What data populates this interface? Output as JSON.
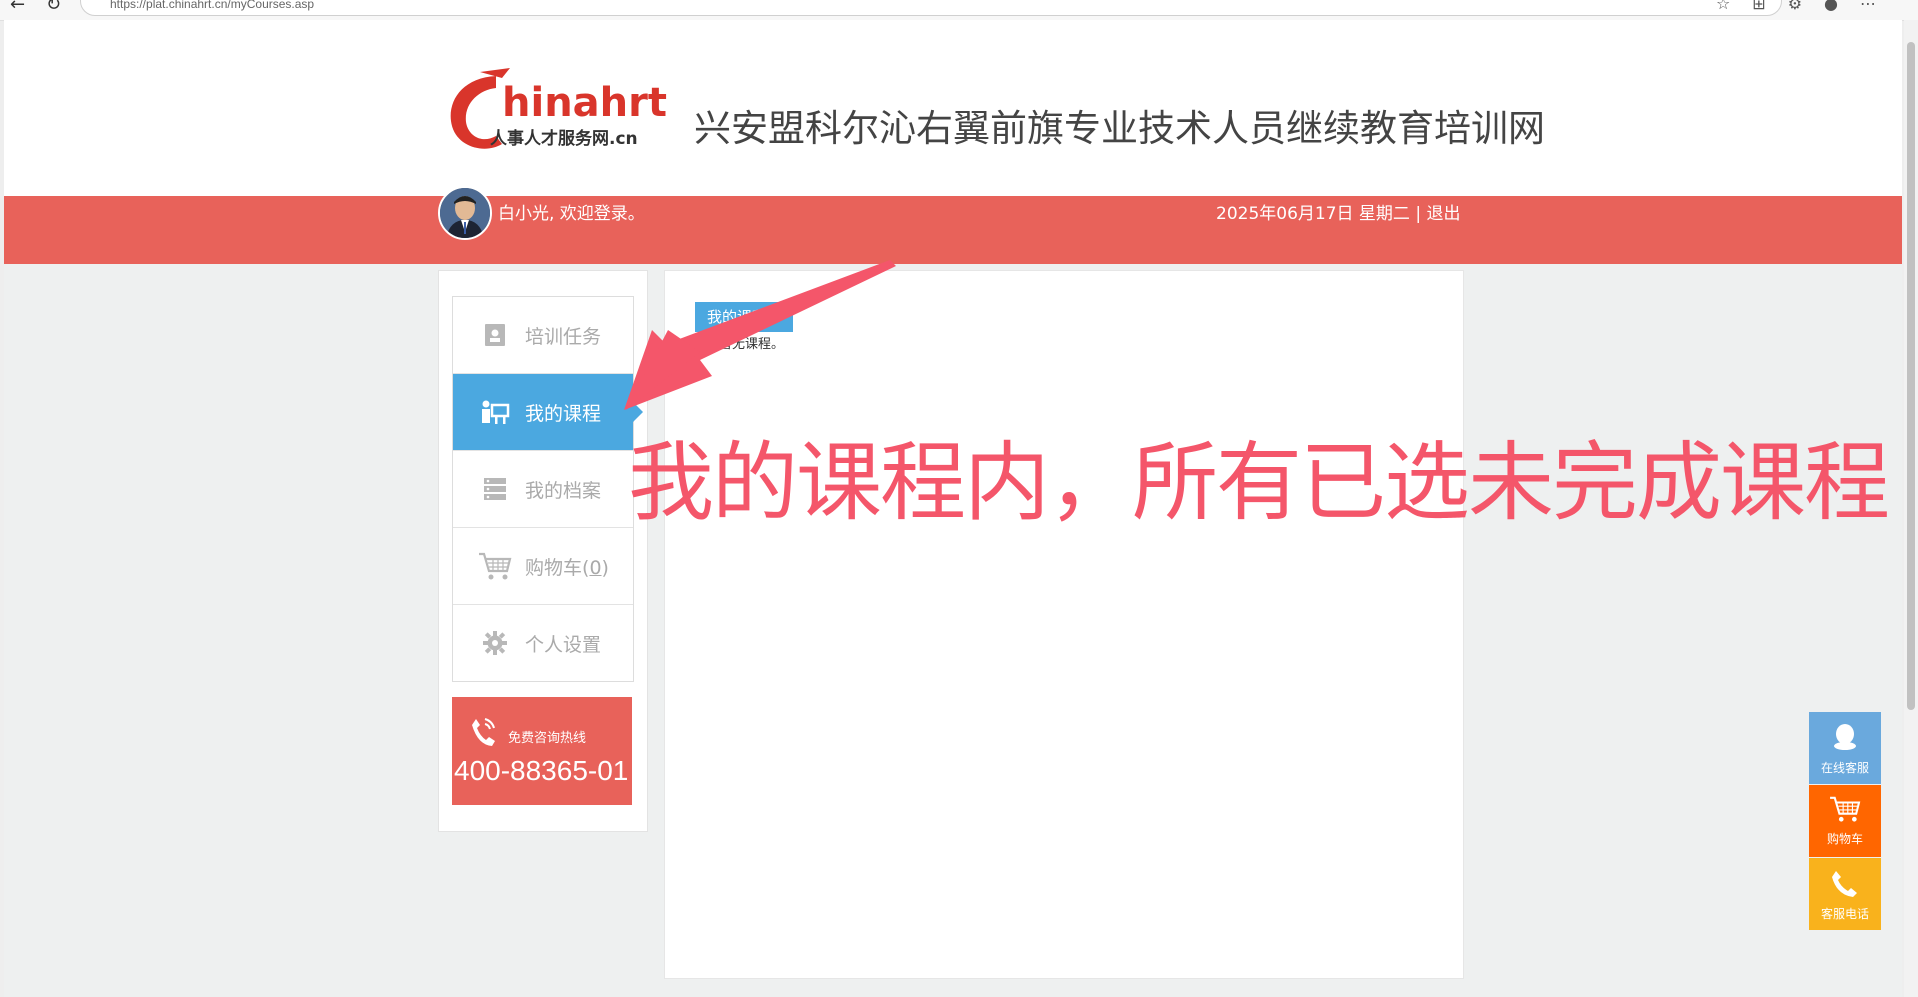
{
  "browser": {
    "url": "https://plat.chinahrt.cn/myCourses.asp"
  },
  "header": {
    "logo_brand": "Chinahrt",
    "logo_sub": "人事人才服务网.cn",
    "site_title": "兴安盟科尔沁右翼前旗专业技术人员继续教育培训网"
  },
  "userbar": {
    "welcome": "白小光, 欢迎登录。",
    "date": "2025年06月17日 星期二",
    "separator": "|",
    "logout": "退出"
  },
  "sidebar": {
    "items": [
      {
        "label": "培训任务",
        "icon": "task-icon",
        "active": false
      },
      {
        "label": "我的课程",
        "icon": "teacher-icon",
        "active": true
      },
      {
        "label": "我的档案",
        "icon": "archive-icon",
        "active": false
      },
      {
        "label": "购物车",
        "count": "0",
        "icon": "cart-icon",
        "active": false
      },
      {
        "label": "个人设置",
        "icon": "gear-icon",
        "active": false
      }
    ],
    "hotline": {
      "title": "免费咨询热线",
      "phone": "400-88365-01"
    }
  },
  "content": {
    "tab_label": "我的课程",
    "note": "暂无课程。"
  },
  "annotation": {
    "text": "我的课程内，所有已选未完成课程",
    "color": "#f4566a"
  },
  "float_buttons": [
    {
      "label": "在线客服",
      "icon": "qq-icon",
      "color": "#6aa9dd"
    },
    {
      "label": "购物车",
      "icon": "cart-icon",
      "color": "#ff6600"
    },
    {
      "label": "客服电话",
      "icon": "phone-icon",
      "color": "#f9b21c"
    }
  ],
  "colors": {
    "brand_red": "#e8625a",
    "active_blue": "#4ba8e0"
  }
}
